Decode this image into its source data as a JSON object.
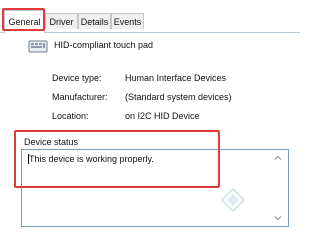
{
  "tabs": [
    {
      "label": "General",
      "active": true
    },
    {
      "label": "Driver",
      "active": false
    },
    {
      "label": "Details",
      "active": false
    },
    {
      "label": "Events",
      "active": false
    }
  ],
  "device": {
    "name": "HID-compliant touch pad",
    "icon": "hid-device-icon"
  },
  "properties": [
    {
      "label": "Device type:",
      "value": "Human Interface Devices"
    },
    {
      "label": "Manufacturer:",
      "value": "(Standard system devices)"
    },
    {
      "label": "Location:",
      "value": "on I2C HID Device"
    }
  ],
  "status": {
    "section_label": "Device status",
    "text": "This device is working properly."
  },
  "colors": {
    "highlight": "#e23a3a",
    "status_border": "#7a9cc0"
  }
}
